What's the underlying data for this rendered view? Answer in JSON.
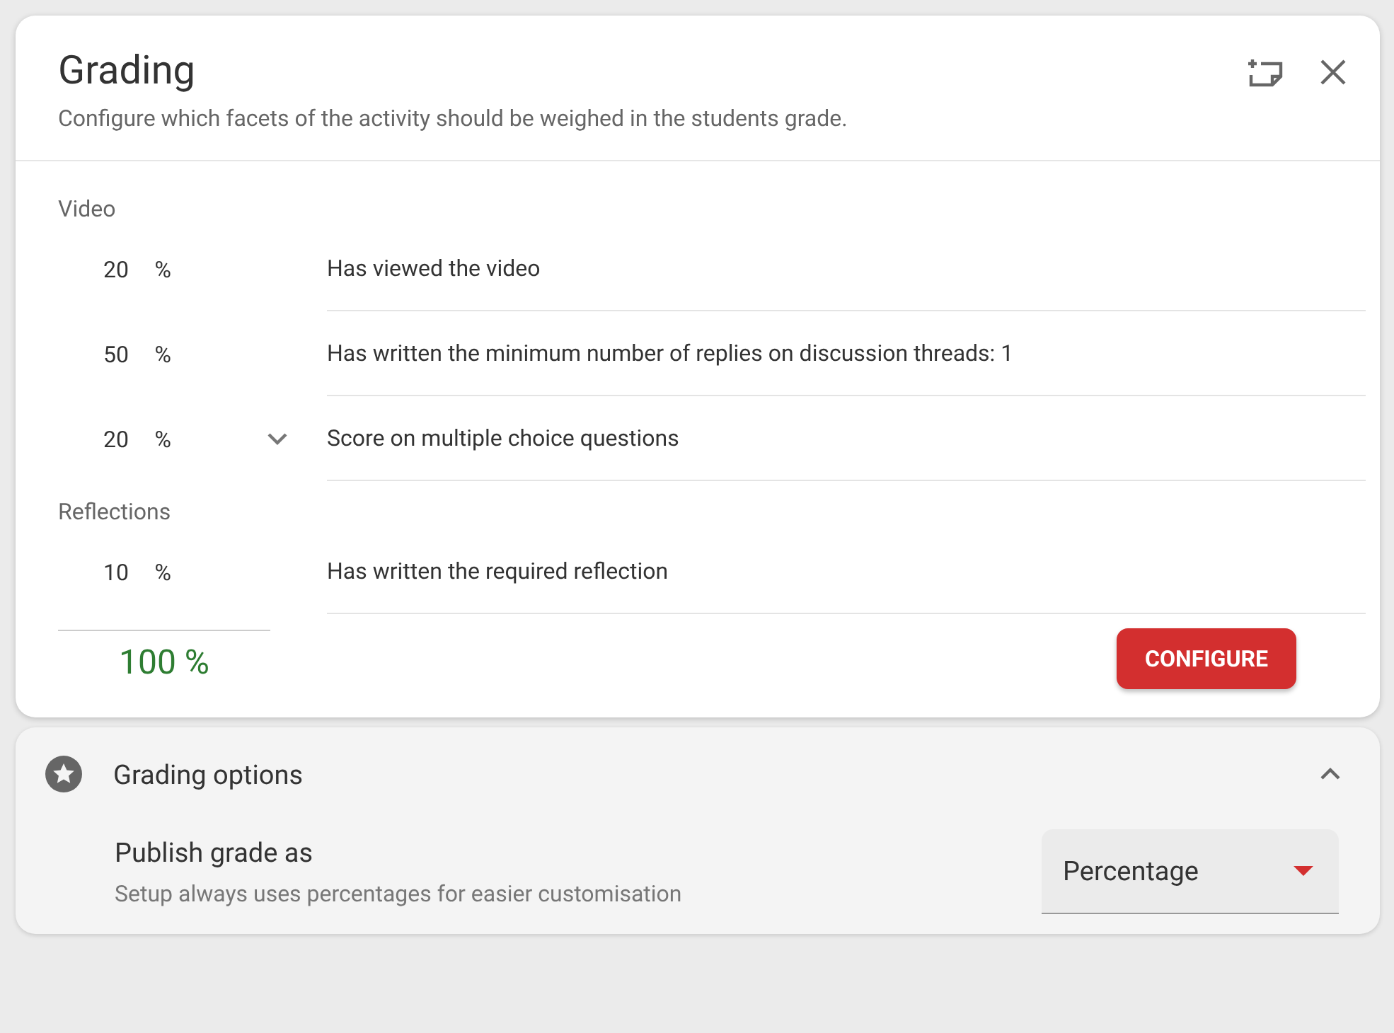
{
  "dialog": {
    "title": "Grading",
    "subtitle": "Configure which facets of the activity should be weighed in the students grade."
  },
  "sections": [
    {
      "title": "Video",
      "items": [
        {
          "weight": "20",
          "unit": "%",
          "expandable": false,
          "label": "Has viewed the video"
        },
        {
          "weight": "50",
          "unit": "%",
          "expandable": false,
          "label": "Has written the minimum number of replies on discussion threads: 1"
        },
        {
          "weight": "20",
          "unit": "%",
          "expandable": true,
          "label": "Score on multiple choice questions"
        }
      ]
    },
    {
      "title": "Reflections",
      "items": [
        {
          "weight": "10",
          "unit": "%",
          "expandable": false,
          "label": "Has written the required reflection"
        }
      ]
    }
  ],
  "total": "100 %",
  "configure_button": "CONFIGURE",
  "options_panel": {
    "title": "Grading options",
    "expanded": true,
    "setting_label": "Publish grade as",
    "setting_hint": "Setup always uses percentages for easier customisation",
    "select_value": "Percentage"
  }
}
